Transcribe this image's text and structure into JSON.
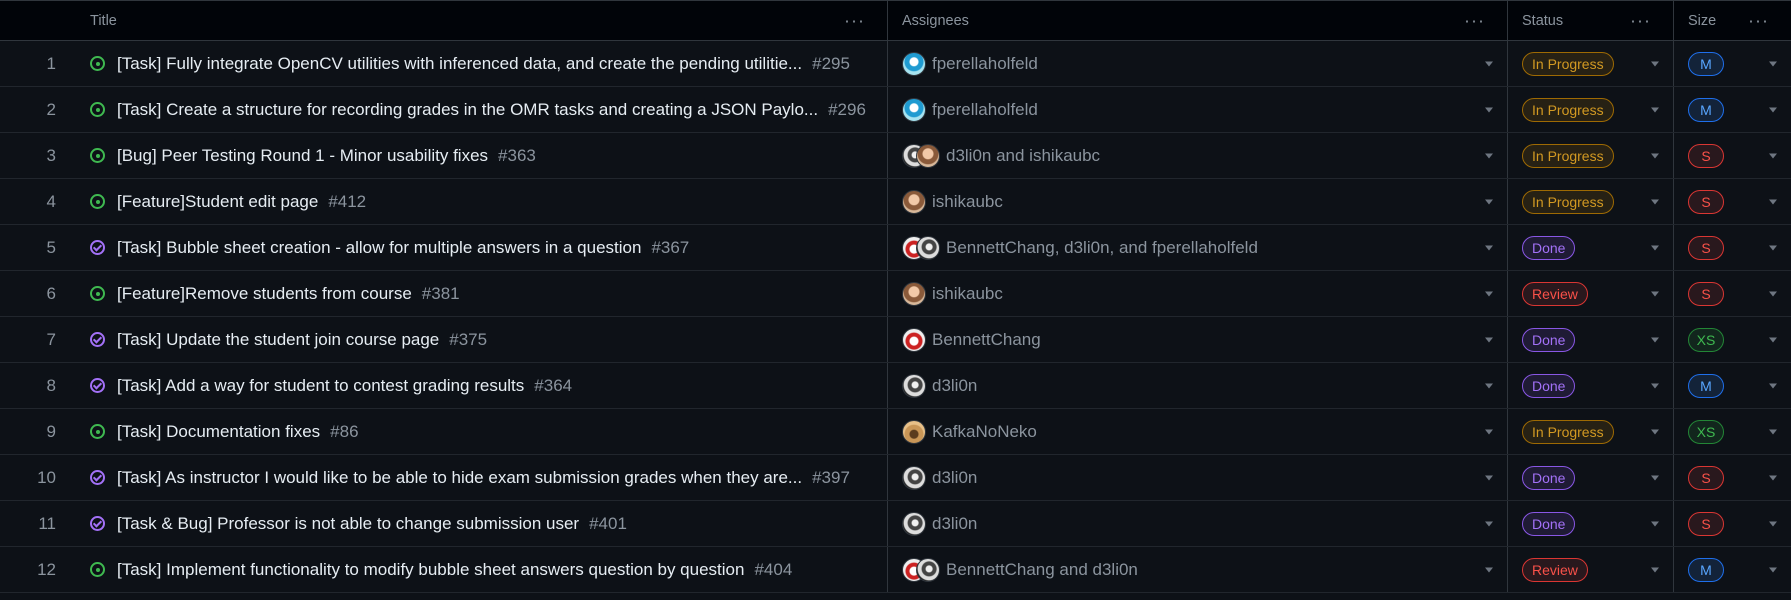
{
  "columns": {
    "title": "Title",
    "assignees": "Assignees",
    "status": "Status",
    "size": "Size"
  },
  "column_menu_icon": "more-horizontal-icon",
  "colors": {
    "background": "#0d1117",
    "open_icon": "#3fb950",
    "closed_icon": "#a371f7",
    "in_progress": "#d29922",
    "done": "#a371f7",
    "review": "#f85149"
  },
  "rows": [
    {
      "num": "1",
      "state": "open",
      "title": "[Task] Fully integrate OpenCV utilities with inferenced data, and create the pending utilitie...",
      "issue": "#295",
      "avatars": [
        "f"
      ],
      "assignees": "fperellaholfeld",
      "status": "In Progress",
      "status_kind": "progress",
      "size": "M",
      "size_kind": "m"
    },
    {
      "num": "2",
      "state": "open",
      "title": "[Task] Create a structure for recording grades in the OMR tasks and creating a JSON Paylo...",
      "issue": "#296",
      "avatars": [
        "f"
      ],
      "assignees": "fperellaholfeld",
      "status": "In Progress",
      "status_kind": "progress",
      "size": "M",
      "size_kind": "m"
    },
    {
      "num": "3",
      "state": "open",
      "title": "[Bug] Peer Testing Round 1 - Minor usability fixes",
      "issue": "#363",
      "avatars": [
        "d",
        "i"
      ],
      "assignees": "d3li0n and ishikaubc",
      "status": "In Progress",
      "status_kind": "progress",
      "size": "S",
      "size_kind": "s"
    },
    {
      "num": "4",
      "state": "open",
      "title": "[Feature]Student edit page",
      "issue": "#412",
      "avatars": [
        "i"
      ],
      "assignees": "ishikaubc",
      "status": "In Progress",
      "status_kind": "progress",
      "size": "S",
      "size_kind": "s"
    },
    {
      "num": "5",
      "state": "closed",
      "title": "[Task] Bubble sheet creation - allow for multiple answers in a question",
      "issue": "#367",
      "avatars": [
        "b",
        "d"
      ],
      "assignees": "BennettChang, d3li0n, and fperellaholfeld",
      "status": "Done",
      "status_kind": "done",
      "size": "S",
      "size_kind": "s"
    },
    {
      "num": "6",
      "state": "open",
      "title": "[Feature]Remove students from course",
      "issue": "#381",
      "avatars": [
        "i"
      ],
      "assignees": "ishikaubc",
      "status": "Review",
      "status_kind": "review",
      "size": "S",
      "size_kind": "s"
    },
    {
      "num": "7",
      "state": "closed",
      "title": "[Task] Update the student join course page",
      "issue": "#375",
      "avatars": [
        "b"
      ],
      "assignees": "BennettChang",
      "status": "Done",
      "status_kind": "done",
      "size": "XS",
      "size_kind": "xs"
    },
    {
      "num": "8",
      "state": "closed",
      "title": "[Task] Add a way for student to contest grading results",
      "issue": "#364",
      "avatars": [
        "d"
      ],
      "assignees": "d3li0n",
      "status": "Done",
      "status_kind": "done",
      "size": "M",
      "size_kind": "m"
    },
    {
      "num": "9",
      "state": "open",
      "title": "[Task] Documentation fixes",
      "issue": "#86",
      "avatars": [
        "k"
      ],
      "assignees": "KafkaNoNeko",
      "status": "In Progress",
      "status_kind": "progress",
      "size": "XS",
      "size_kind": "xs"
    },
    {
      "num": "10",
      "state": "closed",
      "title": "[Task] As instructor I would like to be able to hide exam submission grades when they are...",
      "issue": "#397",
      "avatars": [
        "d"
      ],
      "assignees": "d3li0n",
      "status": "Done",
      "status_kind": "done",
      "size": "S",
      "size_kind": "s"
    },
    {
      "num": "11",
      "state": "closed",
      "title": "[Task & Bug] Professor is not able to change submission user",
      "issue": "#401",
      "avatars": [
        "d"
      ],
      "assignees": "d3li0n",
      "status": "Done",
      "status_kind": "done",
      "size": "S",
      "size_kind": "s"
    },
    {
      "num": "12",
      "state": "open",
      "title": "[Task] Implement functionality to modify bubble sheet answers question by question",
      "issue": "#404",
      "avatars": [
        "b",
        "d"
      ],
      "assignees": "BennettChang and d3li0n",
      "status": "Review",
      "status_kind": "review",
      "size": "M",
      "size_kind": "m"
    }
  ]
}
